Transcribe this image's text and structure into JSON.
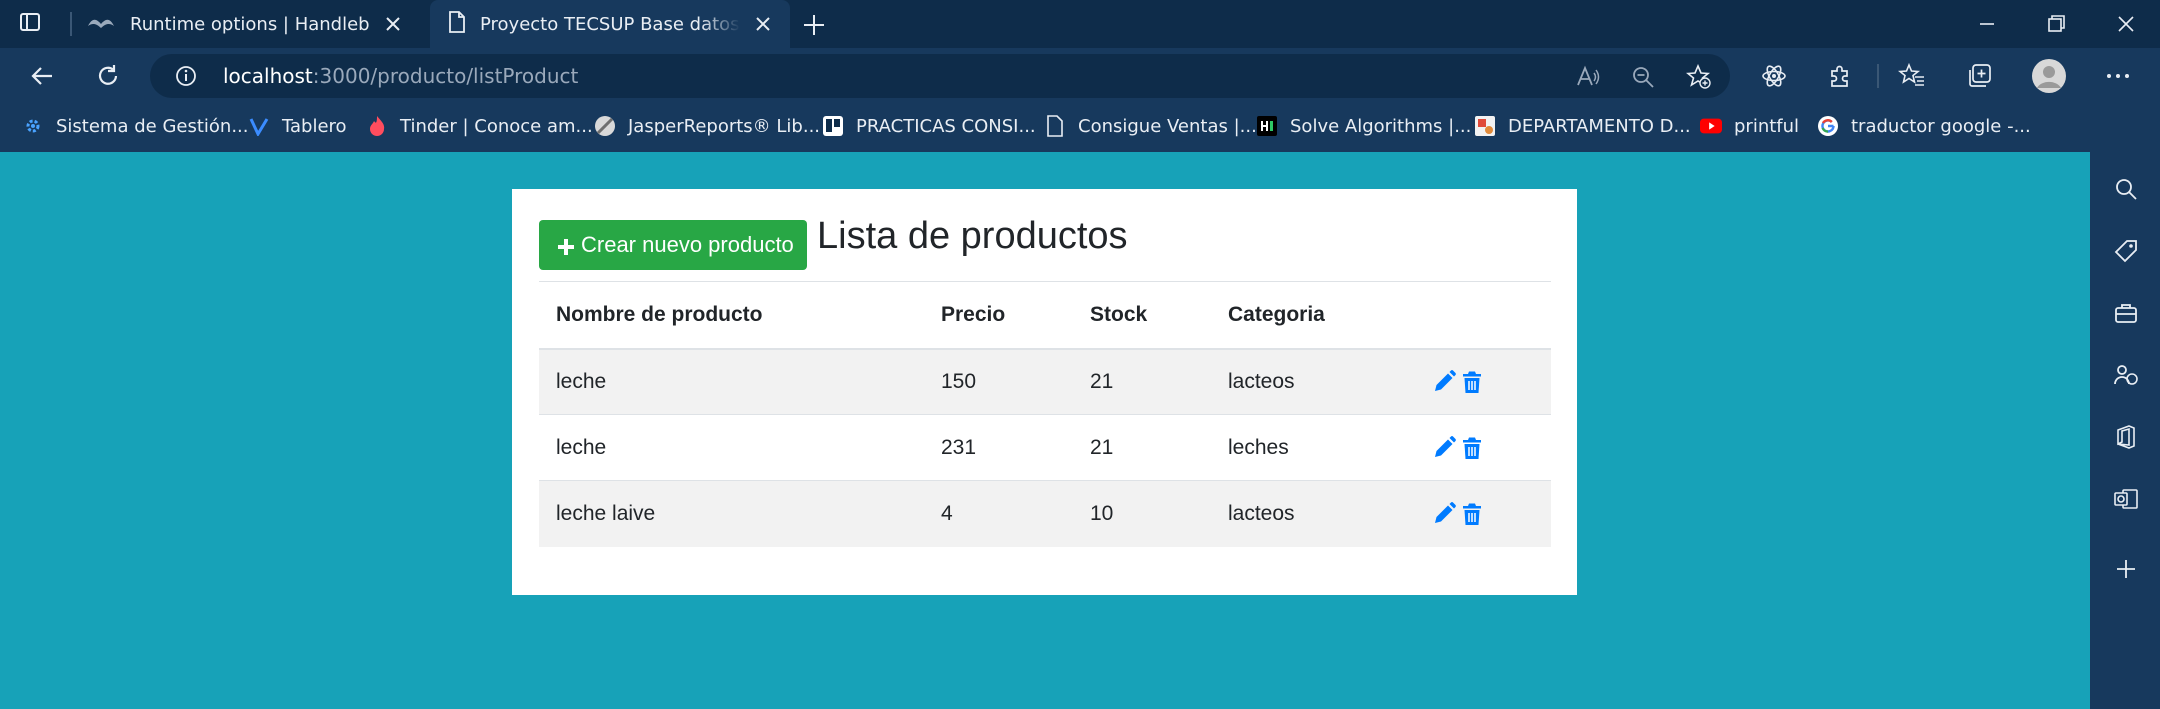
{
  "browser": {
    "tabs": [
      {
        "title": "Runtime options | Handlebars",
        "active": false
      },
      {
        "title": "Proyecto TECSUP Base datos avanzado",
        "active": true
      }
    ],
    "address": {
      "host": "localhost",
      "path": ":3000/producto/listProduct"
    },
    "bookmarks": [
      {
        "label": "Sistema de Gestión...",
        "icon": "gear-icon"
      },
      {
        "label": "Tablero",
        "icon": "v-logo-icon"
      },
      {
        "label": "Tinder | Conoce am...",
        "icon": "flame-icon"
      },
      {
        "label": "JasperReports® Lib...",
        "icon": "jasper-icon"
      },
      {
        "label": "PRACTICAS CONSI...",
        "icon": "trello-icon"
      },
      {
        "label": "Consigue Ventas |...",
        "icon": "page-icon"
      },
      {
        "label": "Solve Algorithms |...",
        "icon": "hackerrank-icon"
      },
      {
        "label": "DEPARTAMENTO D...",
        "icon": "site-icon"
      },
      {
        "label": "printful",
        "icon": "youtube-icon"
      },
      {
        "label": "traductor google -...",
        "icon": "google-icon"
      }
    ],
    "colors": {
      "frame": "#0e2c4a",
      "toolbar": "#17395d",
      "page_bg": "#17a2b8"
    }
  },
  "page": {
    "create_button": "Crear nuevo producto",
    "title": "Lista de productos",
    "columns": [
      "Nombre de producto",
      "Precio",
      "Stock",
      "Categoria",
      ""
    ],
    "rows": [
      {
        "name": "leche",
        "price": "150",
        "stock": "21",
        "category": "lacteos"
      },
      {
        "name": "leche",
        "price": "231",
        "stock": "21",
        "category": "leches"
      },
      {
        "name": "leche laive",
        "price": "4",
        "stock": "10",
        "category": "lacteos"
      }
    ],
    "colors": {
      "create_button": "#28a745",
      "action_icons": "#007bff",
      "row_stripe": "#f2f2f2"
    }
  }
}
